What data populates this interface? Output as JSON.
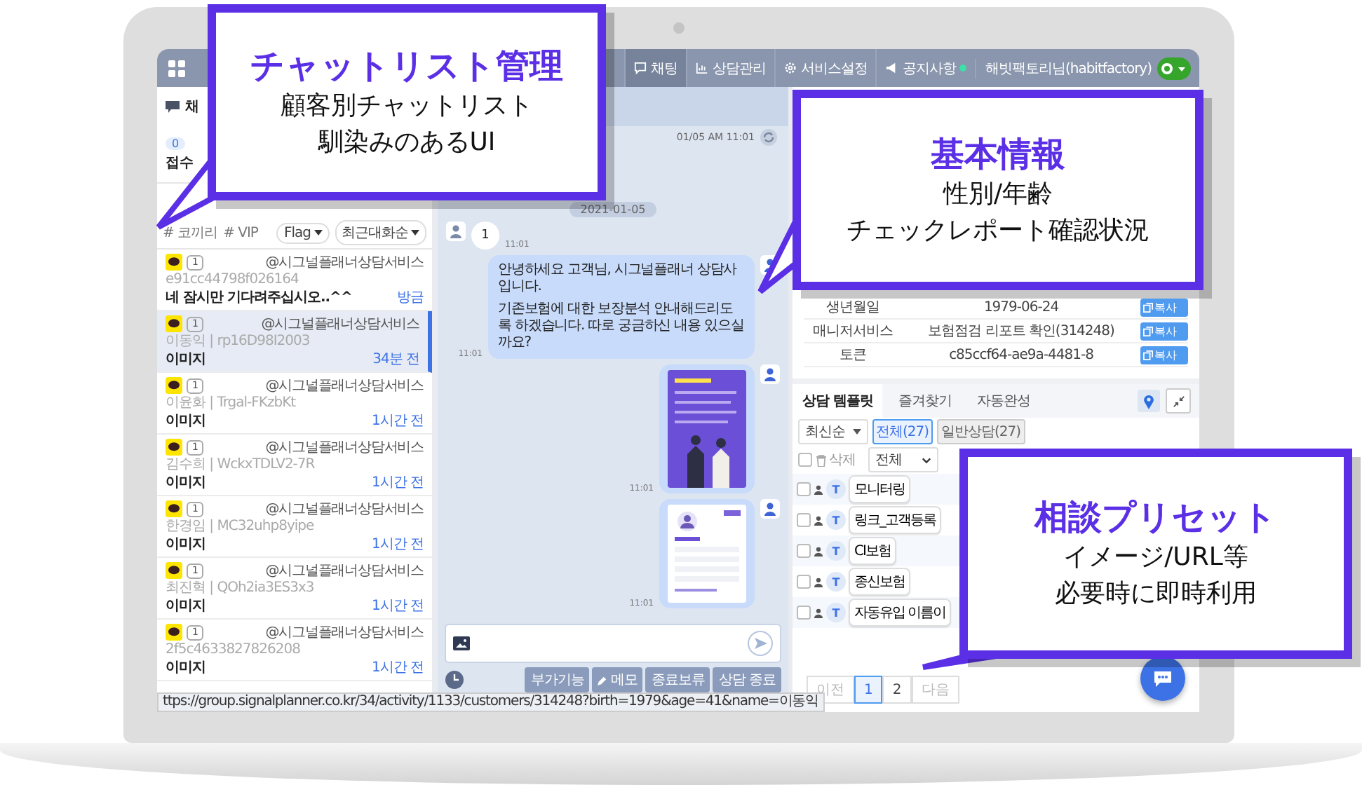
{
  "nav": {
    "tabs": [
      {
        "label": "채팅",
        "kind": "chat",
        "selected": true,
        "notify": false
      },
      {
        "label": "상담관리",
        "kind": "chart",
        "selected": false,
        "notify": false
      },
      {
        "label": "서비스설정",
        "kind": "gear",
        "selected": false,
        "notify": false
      },
      {
        "label": "공지사항",
        "kind": "megaphone",
        "selected": false,
        "notify": true
      }
    ],
    "user": "해빗팩토리님(habitfactory)"
  },
  "chat_list": {
    "title": "채",
    "counter": {
      "value": "0",
      "label": "접수"
    },
    "tags": [
      "# 코끼리",
      "# VIP"
    ],
    "filters": [
      "Flag",
      "최근대화순"
    ],
    "chats": [
      {
        "source": "@시그널플래너상담서비스",
        "unread": "1",
        "customer": "e91cc44798f026164",
        "message": "네 잠시만 기다려주십시오..^^",
        "time": "방금",
        "selected": false
      },
      {
        "source": "@시그널플래너상담서비스",
        "unread": "1",
        "customer": "이동익 | rp16D98I2003",
        "message": "이미지",
        "time": "34분 전",
        "selected": true
      },
      {
        "source": "@시그널플래너상담서비스",
        "unread": "1",
        "customer": "이윤화 | Trgal-FKzbKt",
        "message": "이미지",
        "time": "1시간 전",
        "selected": false
      },
      {
        "source": "@시그널플래너상담서비스",
        "unread": "1",
        "customer": "김수희 | WckxTDLV2-7R",
        "message": "이미지",
        "time": "1시간 전",
        "selected": false
      },
      {
        "source": "@시그널플래너상담서비스",
        "unread": "1",
        "customer": "한경임 | MC32uhp8yipe",
        "message": "이미지",
        "time": "1시간 전",
        "selected": false
      },
      {
        "source": "@시그널플래너상담서비스",
        "unread": "1",
        "customer": "최진혁 | QOh2ia3ES3x3",
        "message": "이미지",
        "time": "1시간 전",
        "selected": false
      },
      {
        "source": "@시그널플래너상담서비스",
        "unread": "1",
        "customer": "2f5c4633827826208",
        "message": "이미지",
        "time": "1시간 전",
        "selected": false
      }
    ]
  },
  "conversation": {
    "timestamp": "01/05 AM 11:01",
    "date": "2021-01-05",
    "messages": [
      {
        "kind": "customer",
        "text": "1",
        "time": "11:01"
      },
      {
        "kind": "text",
        "paragraphs": [
          "안녕하세요 고객님, 시그널플래너 상담사 입니다.",
          "기존보험에 대한 보장분석 안내해드리도록 하겠습니다. 따로 궁금하신 내용 있으실까요?"
        ],
        "time": "11:01"
      },
      {
        "kind": "poster",
        "time": "11:01"
      },
      {
        "kind": "card",
        "time": "11:01"
      }
    ],
    "actions": [
      {
        "label": "부가기능",
        "kind": "plain"
      },
      {
        "label": "메모",
        "kind": "memo"
      },
      {
        "label": "종료보류",
        "kind": "plain"
      },
      {
        "label": "상담 종료",
        "kind": "plain"
      }
    ]
  },
  "customer_info": {
    "rows": [
      {
        "label": "생년월일",
        "value": "1979-06-24",
        "action": "복사"
      },
      {
        "label": "매니저서비스",
        "value": "보험점검 리포트 확인(314248)",
        "action": "복사"
      },
      {
        "label": "토큰",
        "value": "c85ccf64-ae9a-4481-8",
        "action": "복사"
      }
    ],
    "tabs": [
      {
        "label": "상담 템플릿",
        "selected": true
      },
      {
        "label": "즐겨찾기",
        "selected": false
      },
      {
        "label": "자동완성",
        "selected": false
      }
    ],
    "sort": "최신순",
    "chips": [
      {
        "label": "전체(27)",
        "selected": true
      },
      {
        "label": "일반상담(27)",
        "selected": false
      }
    ],
    "select_all_checked": false,
    "delete": "삭제",
    "category": "전체",
    "templates": [
      {
        "badge": "T",
        "label": "모니터링",
        "checked": false
      },
      {
        "badge": "T",
        "label": "링크_고객등록",
        "checked": false
      },
      {
        "badge": "T",
        "label": "CI보험",
        "checked": false
      },
      {
        "badge": "T",
        "label": "종신보험",
        "checked": false
      },
      {
        "badge": "T",
        "label": "자동유입 이름이",
        "checked": false
      }
    ],
    "pages": [
      {
        "label": "이전",
        "selected": false,
        "disabled": true
      },
      {
        "label": "1",
        "selected": true,
        "disabled": false
      },
      {
        "label": "2",
        "selected": false,
        "disabled": false
      },
      {
        "label": "다음",
        "selected": false,
        "disabled": true
      }
    ]
  },
  "status_url": "ttps://group.signalplanner.co.kr/34/activity/1133/customers/314248?birth=1979&age=41&name=이동익",
  "callouts": [
    {
      "title": "チャットリスト管理",
      "lines": [
        "顧客別チャットリスト",
        "馴染みのあるUI"
      ]
    },
    {
      "title": "基本情報",
      "lines": [
        "性別/年齢",
        "チェックレポート確認状況"
      ]
    },
    {
      "title": "相談プリセット",
      "lines": [
        "イメージ/URL等",
        "必要時に即時利用"
      ]
    }
  ]
}
